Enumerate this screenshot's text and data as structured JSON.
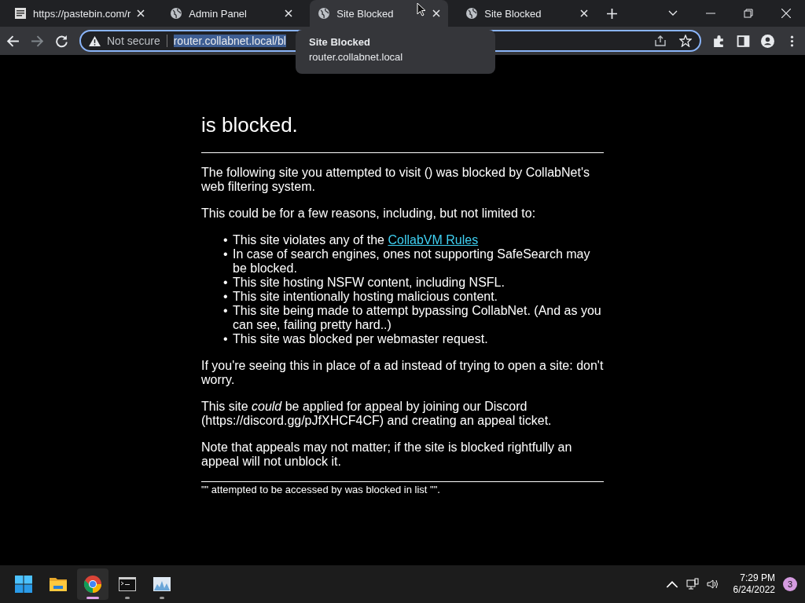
{
  "tabs": [
    {
      "title": "https://pastebin.com/r",
      "kind": "pastebin",
      "selected": false
    },
    {
      "title": "Admin Panel",
      "kind": "globe",
      "selected": false
    },
    {
      "title": "Site Blocked",
      "kind": "globe",
      "selected": true
    },
    {
      "title": "Site Blocked",
      "kind": "globe",
      "selected": false
    }
  ],
  "address_bar": {
    "security": "Not secure",
    "url": "router.collabnet.local/bl"
  },
  "tooltip": {
    "title": "Site Blocked",
    "host": "router.collabnet.local"
  },
  "page": {
    "heading": "is blocked.",
    "intro": "The following site you attempted to visit () was blocked by CollabNet's web filtering system.",
    "reasons_intro": "This could be for a few reasons, including, but not limited to:",
    "reasons": [
      {
        "bullet": "•",
        "text": "This site violates any of the ",
        "link": "CollabVM Rules"
      },
      {
        "bullet": "•",
        "text": "In case of search engines, ones not supporting SafeSearch may be blocked."
      },
      {
        "bullet": "•",
        "text": "This site hosting NSFW content, including NSFL."
      },
      {
        "bullet": "•",
        "text": "This site intentionally hosting malicious content."
      },
      {
        "bullet": "•",
        "text": "This site being made to attempt bypassing CollabNet. (And as you can see, failing pretty hard..)"
      },
      {
        "bullet": "•",
        "text": "This site was blocked per webmaster request."
      }
    ],
    "paragraphs": [
      "If you're seeing this in place of a ad instead of trying to open a site: don't worry.",
      "This site *could* be applied for appeal by joining our Discord (https://discord.gg/pJfXHCF4CF) and creating an appeal ticket.",
      "Note that appeals may not matter; if the site is blocked rightfully an appeal will not unblock it."
    ],
    "footer": "\"\" attempted to be accessed by was blocked in list \"\"."
  },
  "taskbar": {
    "apps": [
      {
        "kind": "start",
        "running": false,
        "selected": false
      },
      {
        "kind": "explorer",
        "running": false,
        "selected": false
      },
      {
        "kind": "chrome",
        "running": true,
        "selected": true
      },
      {
        "kind": "terminal",
        "running": true,
        "selected": false
      },
      {
        "kind": "monitor",
        "running": true,
        "selected": false
      }
    ],
    "time": "7:29 PM",
    "date": "6/24/2022",
    "notifications": "3"
  }
}
